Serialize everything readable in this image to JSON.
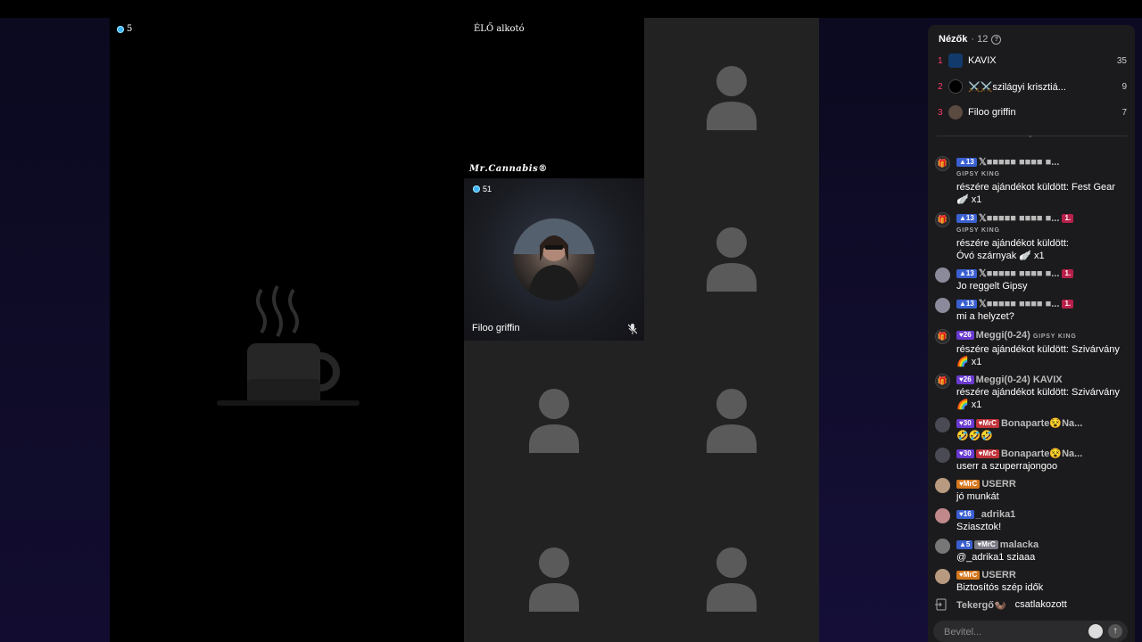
{
  "stage": {
    "host_viewer_count": "5",
    "live_creator_label": "ÉLŐ alkotó",
    "creator_name": "𝑴𝒓.𝑪𝒂𝒏𝒏𝒂𝒃𝒊𝒔®",
    "guest": {
      "count": "51",
      "name": "Filoo griffin"
    }
  },
  "sidebar": {
    "viewers_label": "Nézők",
    "viewers_count": "· 12",
    "top": [
      {
        "rank": "1",
        "name": "KAVIX",
        "score": "35"
      },
      {
        "rank": "2",
        "name": "⚔️⚔️szilágyi krisztiá...",
        "score": "9"
      },
      {
        "rank": "3",
        "name": "Filoo griffin",
        "score": "7"
      }
    ],
    "messages": [
      {
        "level": "13",
        "user": "𝕏■■■■■ ■■■■ ■...",
        "sub": "GIPSY KING",
        "text": "részére ajándékot küldött: Fest Gear",
        "extra": "🪽 x1"
      },
      {
        "level": "13",
        "user": "𝕏■■■■■ ■■■■ ■...",
        "rank_badge": "1.",
        "sub": "GIPSY KING",
        "text": "részére ajándékot küldött:",
        "extra": "Óvó szárnyak 🪽 x1"
      },
      {
        "level": "13",
        "user": "𝕏■■■■■ ■■■■ ■...",
        "rank_badge": "1.",
        "text": "Jo reggelt Gipsy"
      },
      {
        "level": "13",
        "user": "𝕏■■■■■ ■■■■ ■...",
        "rank_badge": "1.",
        "text": "mi a helyzet?"
      },
      {
        "level": "26",
        "user": "Meggi(0-24)",
        "target": "GIPSY KING",
        "text": "részére ajándékot küldött: Szivárvány",
        "extra": "🌈 x1"
      },
      {
        "level": "26",
        "user": "Meggi(0-24) KAVIX",
        "text": "részére ajándékot küldött: Szivárvány",
        "extra": "🌈 x1"
      },
      {
        "level": "30",
        "fan": "MrC",
        "user": "Bonaparte😵Na...",
        "text": "🤣🤣🤣"
      },
      {
        "level": "30",
        "fan": "MrC",
        "user": "Bonaparte😵Na...",
        "text": "userr a szuperrajongoo"
      },
      {
        "fan": "MrC",
        "user": "USERR",
        "text": "jó munkát"
      },
      {
        "level": "16",
        "user": "_adrika1",
        "text": "Sziasztok!"
      },
      {
        "level": "5",
        "fan": "MrC",
        "user": "malacka",
        "text": "@_adrika1 sziaaa"
      },
      {
        "fan": "MrC",
        "user": "USERR",
        "text": "Biztosítós szép idők"
      }
    ],
    "join": {
      "user": "Tekergő🦦",
      "text": "csatlakozott"
    },
    "input_placeholder": "Bevitel..."
  },
  "colors": {
    "accent_rank": "#ff3b6b",
    "badge_level": "#3a5fd0",
    "badge_fan": "#c0333a"
  }
}
